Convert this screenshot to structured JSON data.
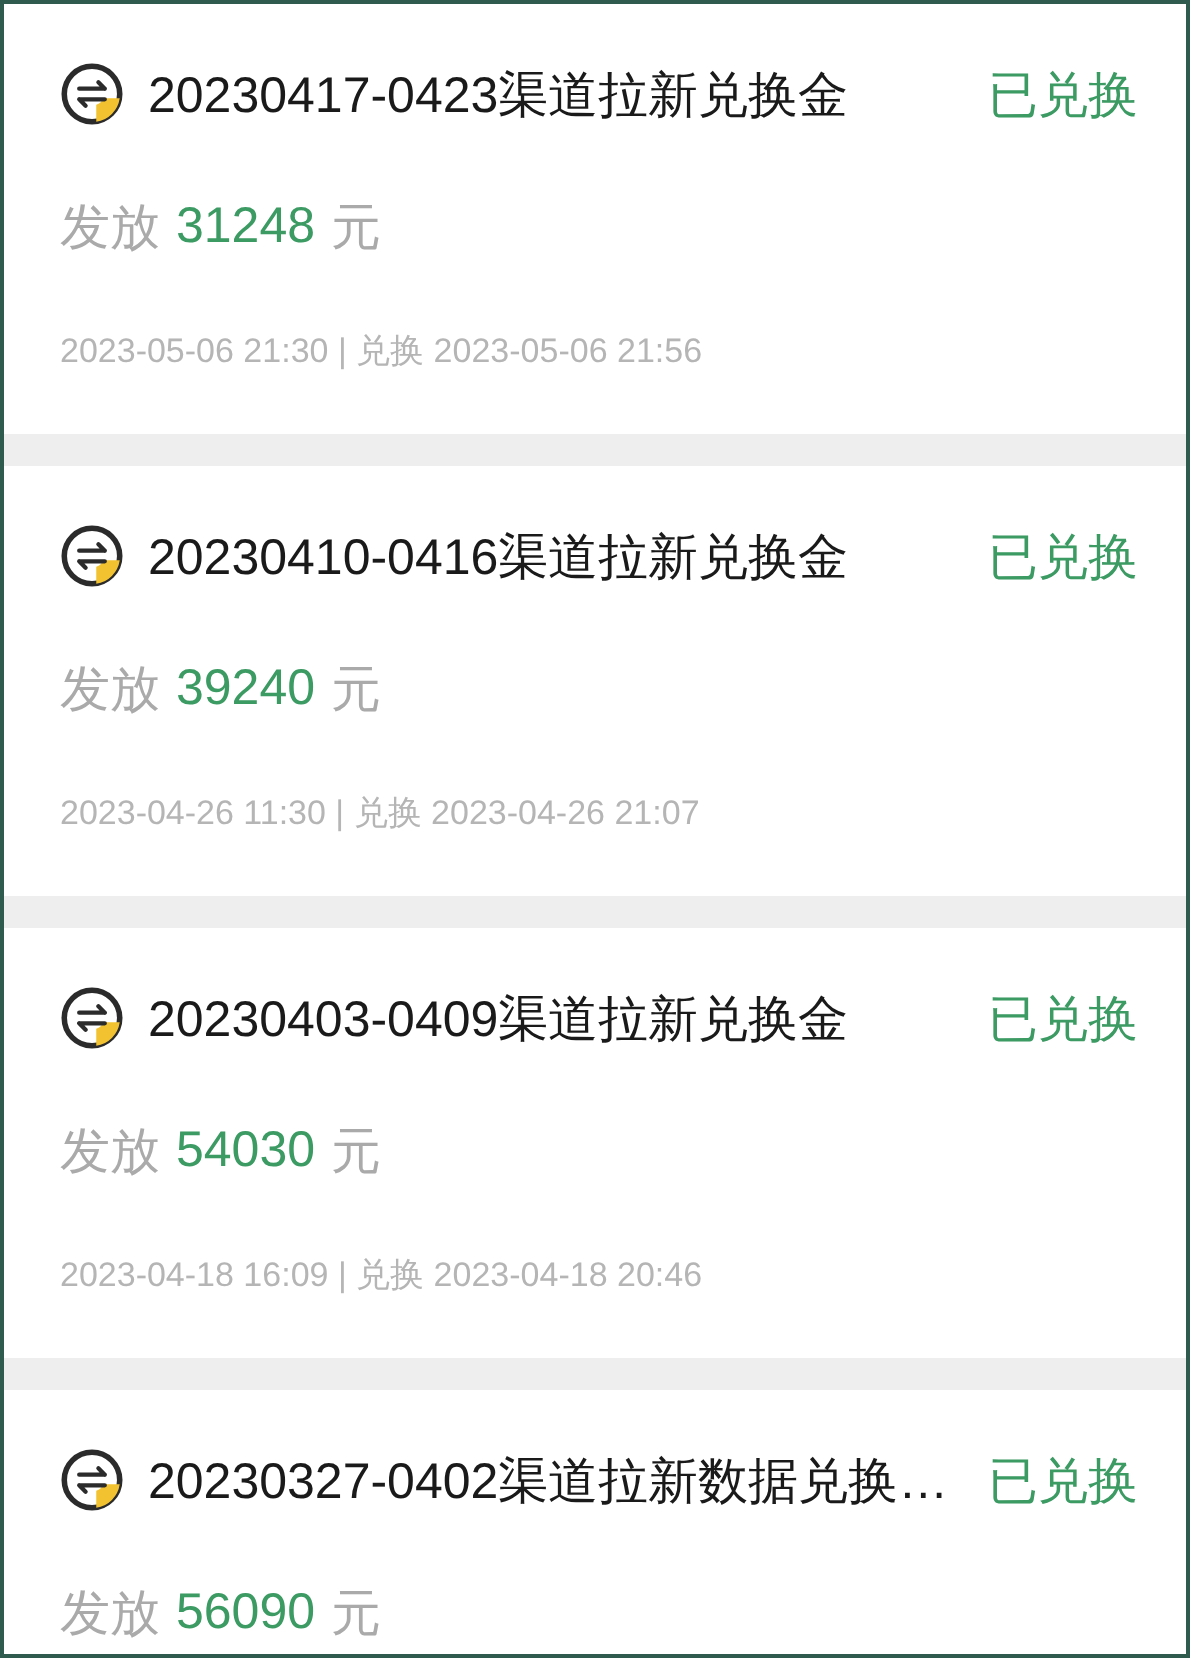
{
  "records": [
    {
      "title": "20230417-0423渠道拉新兑换金",
      "status": "已兑换",
      "amount_label": "发放",
      "amount": "31248",
      "amount_unit": "元",
      "dates": "2023-05-06 21:30 | 兑换 2023-05-06 21:56"
    },
    {
      "title": "20230410-0416渠道拉新兑换金",
      "status": "已兑换",
      "amount_label": "发放",
      "amount": "39240",
      "amount_unit": "元",
      "dates": "2023-04-26 11:30 | 兑换 2023-04-26 21:07"
    },
    {
      "title": "20230403-0409渠道拉新兑换金",
      "status": "已兑换",
      "amount_label": "发放",
      "amount": "54030",
      "amount_unit": "元",
      "dates": "2023-04-18 16:09 | 兑换 2023-04-18 20:46"
    },
    {
      "title": "20230327-0402渠道拉新数据兑换…",
      "status": "已兑换",
      "amount_label": "发放",
      "amount": "56090",
      "amount_unit": "元"
    }
  ]
}
